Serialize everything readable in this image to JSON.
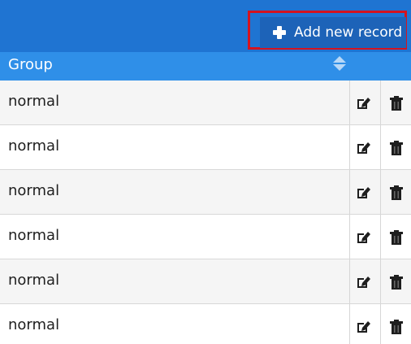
{
  "toolbar": {
    "add_button_label": "Add new record",
    "add_button_icon": "plus-icon"
  },
  "grid": {
    "columns": [
      {
        "label": "Group",
        "sort_icon": "sort-icon"
      }
    ],
    "row_actions": {
      "edit_icon": "edit-icon",
      "delete_icon": "trash-icon"
    },
    "rows": [
      {
        "group": "normal"
      },
      {
        "group": "normal"
      },
      {
        "group": "normal"
      },
      {
        "group": "normal"
      },
      {
        "group": "normal"
      },
      {
        "group": "normal"
      }
    ]
  },
  "colors": {
    "toolbar_bg": "#1f74d2",
    "header_bg": "#2f8fe8",
    "highlight_border": "#d4131f",
    "button_bg": "#1d63b8"
  }
}
